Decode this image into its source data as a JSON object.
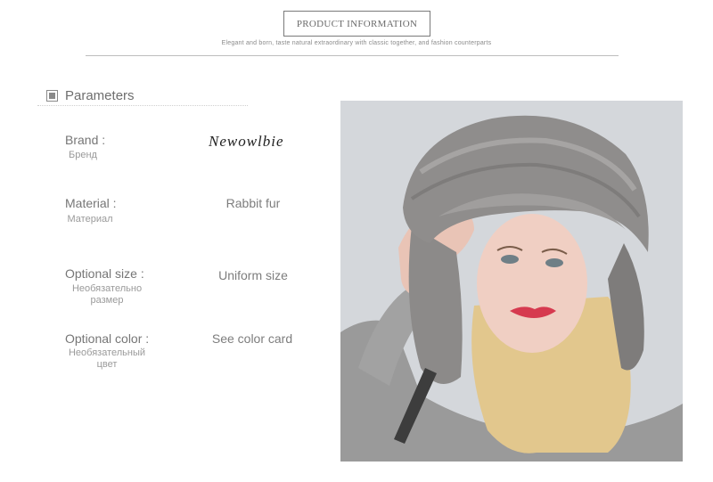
{
  "header": {
    "title": "PRODUCT INFORMATION",
    "tagline": "Elegant and born, taste natural extraordinary with classic together, and fashion counterparts"
  },
  "parameters": {
    "title": "Parameters",
    "rows": [
      {
        "label": "Brand :",
        "sub": "Бренд",
        "value": "Newowlbie"
      },
      {
        "label": "Material :",
        "sub": "Материал",
        "value": "Rabbit fur"
      },
      {
        "label": "Optional size :",
        "sub": "Необязательно размер",
        "value": "Uniform size"
      },
      {
        "label": "Optional color :",
        "sub": "Необязательный цвет",
        "value": "See color card"
      }
    ]
  },
  "colors": {
    "background": "#ffffff",
    "text": "#7d7d7d",
    "photo_background": "#d4d7db",
    "fur": "#8e8c8b"
  }
}
